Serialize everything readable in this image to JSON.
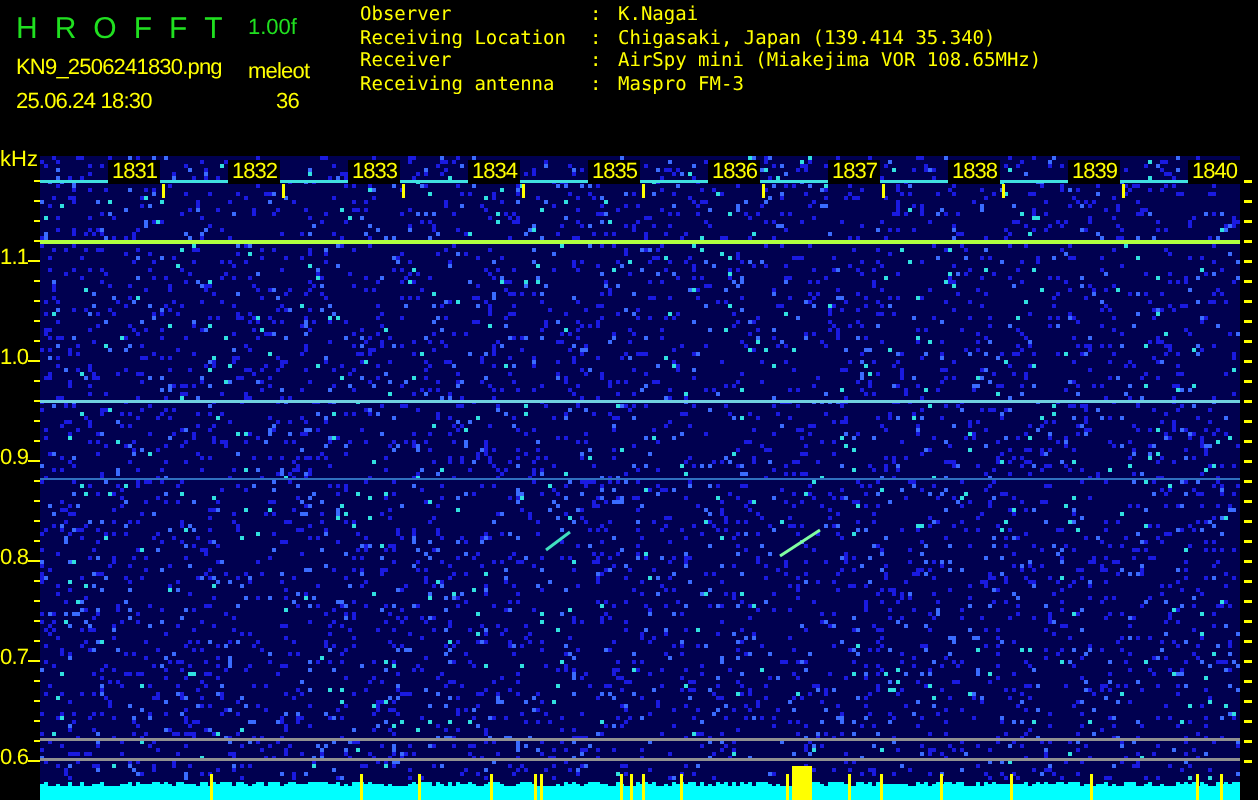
{
  "header": {
    "app_title": "HROFFT",
    "version": "1.00f",
    "filename": "KN9_2506241830.png",
    "meteor_label": "meleot",
    "datetime": "25.06.24  18:30",
    "meteor_count": "36"
  },
  "info": {
    "separator": ":",
    "rows": [
      {
        "label": "Observer",
        "value": "K.Nagai"
      },
      {
        "label": "Receiving Location",
        "value": "Chigasaki, Japan (139.414 35.340)"
      },
      {
        "label": "Receiver",
        "value": "AirSpy mini (Miakejima VOR 108.65MHz)"
      },
      {
        "label": "Receiving antenna",
        "value": "Maspro FM-3"
      }
    ]
  },
  "spectrogram": {
    "unit": "kHz",
    "y_labels": [
      "1.1",
      "1.0",
      "0.9",
      "0.8",
      "0.7",
      "0.6"
    ],
    "time_labels": [
      "1831",
      "1832",
      "1833",
      "1834",
      "1835",
      "1836",
      "1837",
      "1838",
      "1839",
      "1840"
    ]
  }
}
